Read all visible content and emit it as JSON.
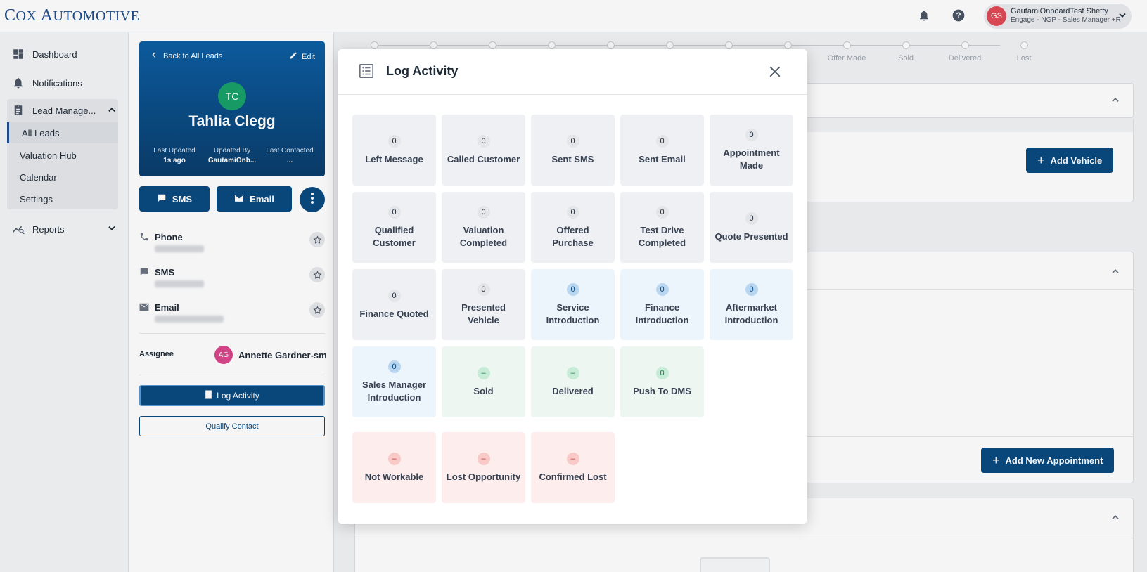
{
  "brand": {
    "logo_first": "C",
    "logo_ox": "OX",
    "logo_auto": "A",
    "logo_rest": "UTOMOTIVE"
  },
  "user": {
    "initials": "GS",
    "name": "GautamiOnboardTest Shetty",
    "role": "Engage - NGP - Sales Manager +R"
  },
  "nav": {
    "dashboard": "Dashboard",
    "notifications": "Notifications",
    "lead_management": "Lead Manage...",
    "all_leads": "All Leads",
    "valuation_hub": "Valuation Hub",
    "calendar": "Calendar",
    "settings": "Settings",
    "reports": "Reports"
  },
  "lead": {
    "back": "Back to All Leads",
    "edit": "Edit",
    "initials": "TC",
    "name": "Tahlia Clegg",
    "last_updated_label": "Last Updated",
    "last_updated_value": "1s ago",
    "updated_by_label": "Updated By",
    "updated_by_value": "GautamiOnb...",
    "last_contacted_label": "Last Contacted",
    "last_contacted_value": "...",
    "sms_btn": "SMS",
    "email_btn": "Email",
    "phone_label": "Phone",
    "sms_label": "SMS",
    "email_label": "Email",
    "assignee_label": "Assignee",
    "assignee_initials": "AG",
    "assignee_name": "Annette Gardner-sm",
    "log_activity_btn": "Log Activity",
    "qualify_btn": "Qualify Contact"
  },
  "stepper": {
    "labels": [
      "Offer Made",
      "Sold",
      "Delivered",
      "Lost"
    ]
  },
  "main": {
    "add_vehicle": "Add Vehicle",
    "add_appointment": "Add New Appointment"
  },
  "modal": {
    "title": "Log Activity",
    "tiles": [
      {
        "label": "Left Message",
        "count": "0",
        "tone": "grey"
      },
      {
        "label": "Called Customer",
        "count": "0",
        "tone": "grey"
      },
      {
        "label": "Sent SMS",
        "count": "0",
        "tone": "grey"
      },
      {
        "label": "Sent Email",
        "count": "0",
        "tone": "grey"
      },
      {
        "label": "Appointment Made",
        "count": "0",
        "tone": "grey"
      },
      {
        "label": "Qualified Customer",
        "count": "0",
        "tone": "grey"
      },
      {
        "label": "Valuation Completed",
        "count": "0",
        "tone": "grey"
      },
      {
        "label": "Offered Purchase",
        "count": "0",
        "tone": "grey"
      },
      {
        "label": "Test Drive Completed",
        "count": "0",
        "tone": "grey"
      },
      {
        "label": "Quote Presented",
        "count": "0",
        "tone": "grey"
      },
      {
        "label": "Finance Quoted",
        "count": "0",
        "tone": "grey"
      },
      {
        "label": "Presented Vehicle",
        "count": "0",
        "tone": "grey"
      },
      {
        "label": "Service Introduction",
        "count": "0",
        "tone": "blue"
      },
      {
        "label": "Finance Introduction",
        "count": "0",
        "tone": "blue"
      },
      {
        "label": "Aftermarket Introduction",
        "count": "0",
        "tone": "blue"
      },
      {
        "label": "Sales Manager Introduction",
        "count": "0",
        "tone": "blue"
      },
      {
        "label": "Sold",
        "count": "–",
        "tone": "green"
      },
      {
        "label": "Delivered",
        "count": "–",
        "tone": "green"
      },
      {
        "label": "Push To DMS",
        "count": "0",
        "tone": "green"
      },
      {
        "label": "Not Workable",
        "count": "–",
        "tone": "red"
      },
      {
        "label": "Lost Opportunity",
        "count": "–",
        "tone": "red"
      },
      {
        "label": "Confirmed Lost",
        "count": "–",
        "tone": "red"
      }
    ]
  }
}
